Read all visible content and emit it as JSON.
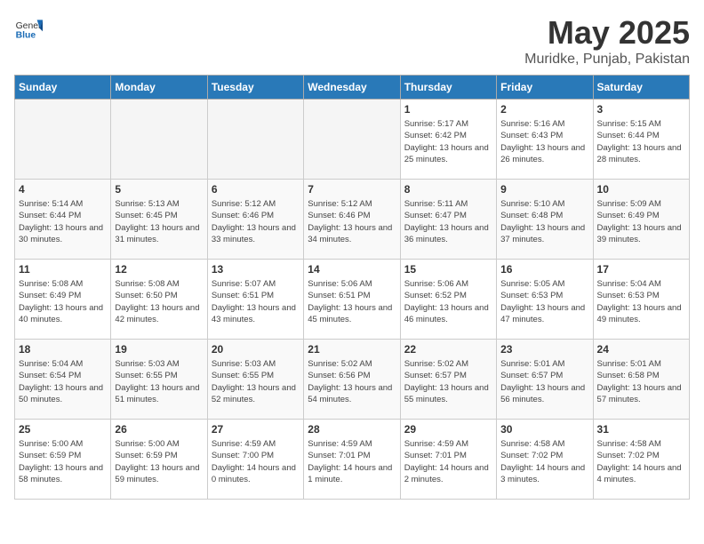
{
  "header": {
    "logo_general": "General",
    "logo_blue": "Blue",
    "month_title": "May 2025",
    "location": "Muridke, Punjab, Pakistan"
  },
  "weekdays": [
    "Sunday",
    "Monday",
    "Tuesday",
    "Wednesday",
    "Thursday",
    "Friday",
    "Saturday"
  ],
  "weeks": [
    [
      {
        "day": "",
        "info": ""
      },
      {
        "day": "",
        "info": ""
      },
      {
        "day": "",
        "info": ""
      },
      {
        "day": "",
        "info": ""
      },
      {
        "day": "1",
        "info": "Sunrise: 5:17 AM\nSunset: 6:42 PM\nDaylight: 13 hours\nand 25 minutes."
      },
      {
        "day": "2",
        "info": "Sunrise: 5:16 AM\nSunset: 6:43 PM\nDaylight: 13 hours\nand 26 minutes."
      },
      {
        "day": "3",
        "info": "Sunrise: 5:15 AM\nSunset: 6:44 PM\nDaylight: 13 hours\nand 28 minutes."
      }
    ],
    [
      {
        "day": "4",
        "info": "Sunrise: 5:14 AM\nSunset: 6:44 PM\nDaylight: 13 hours\nand 30 minutes."
      },
      {
        "day": "5",
        "info": "Sunrise: 5:13 AM\nSunset: 6:45 PM\nDaylight: 13 hours\nand 31 minutes."
      },
      {
        "day": "6",
        "info": "Sunrise: 5:12 AM\nSunset: 6:46 PM\nDaylight: 13 hours\nand 33 minutes."
      },
      {
        "day": "7",
        "info": "Sunrise: 5:12 AM\nSunset: 6:46 PM\nDaylight: 13 hours\nand 34 minutes."
      },
      {
        "day": "8",
        "info": "Sunrise: 5:11 AM\nSunset: 6:47 PM\nDaylight: 13 hours\nand 36 minutes."
      },
      {
        "day": "9",
        "info": "Sunrise: 5:10 AM\nSunset: 6:48 PM\nDaylight: 13 hours\nand 37 minutes."
      },
      {
        "day": "10",
        "info": "Sunrise: 5:09 AM\nSunset: 6:49 PM\nDaylight: 13 hours\nand 39 minutes."
      }
    ],
    [
      {
        "day": "11",
        "info": "Sunrise: 5:08 AM\nSunset: 6:49 PM\nDaylight: 13 hours\nand 40 minutes."
      },
      {
        "day": "12",
        "info": "Sunrise: 5:08 AM\nSunset: 6:50 PM\nDaylight: 13 hours\nand 42 minutes."
      },
      {
        "day": "13",
        "info": "Sunrise: 5:07 AM\nSunset: 6:51 PM\nDaylight: 13 hours\nand 43 minutes."
      },
      {
        "day": "14",
        "info": "Sunrise: 5:06 AM\nSunset: 6:51 PM\nDaylight: 13 hours\nand 45 minutes."
      },
      {
        "day": "15",
        "info": "Sunrise: 5:06 AM\nSunset: 6:52 PM\nDaylight: 13 hours\nand 46 minutes."
      },
      {
        "day": "16",
        "info": "Sunrise: 5:05 AM\nSunset: 6:53 PM\nDaylight: 13 hours\nand 47 minutes."
      },
      {
        "day": "17",
        "info": "Sunrise: 5:04 AM\nSunset: 6:53 PM\nDaylight: 13 hours\nand 49 minutes."
      }
    ],
    [
      {
        "day": "18",
        "info": "Sunrise: 5:04 AM\nSunset: 6:54 PM\nDaylight: 13 hours\nand 50 minutes."
      },
      {
        "day": "19",
        "info": "Sunrise: 5:03 AM\nSunset: 6:55 PM\nDaylight: 13 hours\nand 51 minutes."
      },
      {
        "day": "20",
        "info": "Sunrise: 5:03 AM\nSunset: 6:55 PM\nDaylight: 13 hours\nand 52 minutes."
      },
      {
        "day": "21",
        "info": "Sunrise: 5:02 AM\nSunset: 6:56 PM\nDaylight: 13 hours\nand 54 minutes."
      },
      {
        "day": "22",
        "info": "Sunrise: 5:02 AM\nSunset: 6:57 PM\nDaylight: 13 hours\nand 55 minutes."
      },
      {
        "day": "23",
        "info": "Sunrise: 5:01 AM\nSunset: 6:57 PM\nDaylight: 13 hours\nand 56 minutes."
      },
      {
        "day": "24",
        "info": "Sunrise: 5:01 AM\nSunset: 6:58 PM\nDaylight: 13 hours\nand 57 minutes."
      }
    ],
    [
      {
        "day": "25",
        "info": "Sunrise: 5:00 AM\nSunset: 6:59 PM\nDaylight: 13 hours\nand 58 minutes."
      },
      {
        "day": "26",
        "info": "Sunrise: 5:00 AM\nSunset: 6:59 PM\nDaylight: 13 hours\nand 59 minutes."
      },
      {
        "day": "27",
        "info": "Sunrise: 4:59 AM\nSunset: 7:00 PM\nDaylight: 14 hours\nand 0 minutes."
      },
      {
        "day": "28",
        "info": "Sunrise: 4:59 AM\nSunset: 7:01 PM\nDaylight: 14 hours\nand 1 minute."
      },
      {
        "day": "29",
        "info": "Sunrise: 4:59 AM\nSunset: 7:01 PM\nDaylight: 14 hours\nand 2 minutes."
      },
      {
        "day": "30",
        "info": "Sunrise: 4:58 AM\nSunset: 7:02 PM\nDaylight: 14 hours\nand 3 minutes."
      },
      {
        "day": "31",
        "info": "Sunrise: 4:58 AM\nSunset: 7:02 PM\nDaylight: 14 hours\nand 4 minutes."
      }
    ]
  ]
}
